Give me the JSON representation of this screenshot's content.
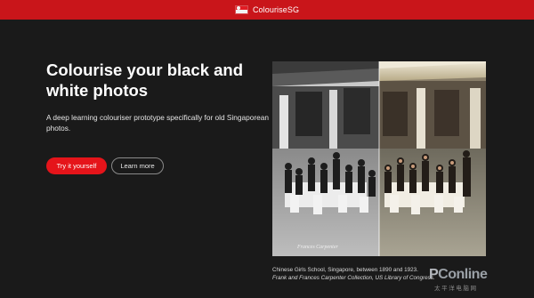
{
  "header": {
    "brand": "ColouriseSG",
    "flag_icon": "singapore-flag-icon"
  },
  "hero": {
    "title": "Colourise your black and white photos",
    "subtitle": "A deep learning colouriser prototype specifically for old Singaporean photos.",
    "primary_button": "Try it yourself",
    "secondary_button": "Learn more"
  },
  "photo": {
    "caption_line1": "Chinese Girls School, Singapore, between 1890 and 1923.",
    "caption_line2": "Frank and Frances Carpenter Collection, US Library of Congress.",
    "signature": "Frances Carpenter"
  },
  "watermark": {
    "brand_p": "P",
    "brand_rest": "Conline",
    "sub": "太平洋电脑网"
  },
  "colors": {
    "accent": "#e5141a",
    "header_bg": "#c9151a",
    "background": "#1a1a1a"
  }
}
